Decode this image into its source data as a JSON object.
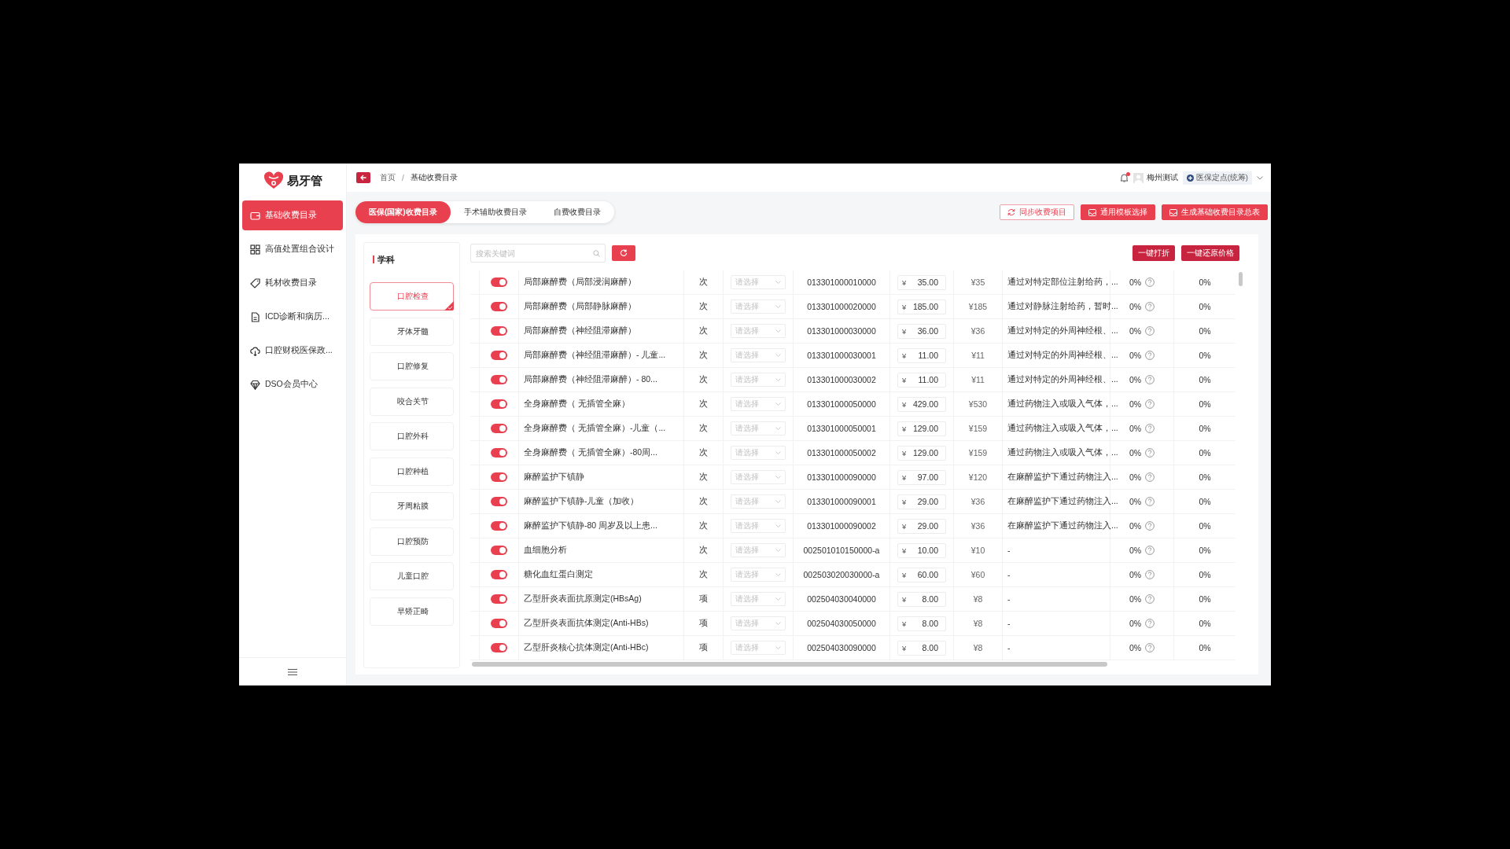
{
  "logo": {
    "text": "易牙管"
  },
  "sidebar": {
    "items": [
      {
        "label": "基础收费目录",
        "selected": true
      },
      {
        "label": "高值处置组合设计",
        "selected": false
      },
      {
        "label": "耗材收费目录",
        "selected": false
      },
      {
        "label": "ICD诊断和病历...",
        "selected": false
      },
      {
        "label": "口腔财税医保政...",
        "selected": false
      },
      {
        "label": "DSO会员中心",
        "selected": false
      }
    ]
  },
  "header": {
    "breadcrumb": [
      {
        "label": "首页"
      },
      {
        "label": "基础收费目录"
      }
    ],
    "separator": "/",
    "notification_dot": true,
    "user": "梅州测试",
    "org_badge": "医保定点(统筹)"
  },
  "tabs": [
    {
      "label": "医保(国家)收费目录",
      "selected": true
    },
    {
      "label": "手术辅助收费目录",
      "selected": false
    },
    {
      "label": "自费收费目录",
      "selected": false
    }
  ],
  "actions": [
    {
      "label": "同步收费项目",
      "kind": "outline"
    },
    {
      "label": "通用模板选择",
      "kind": "filled"
    },
    {
      "label": "生成基础收费目录总表",
      "kind": "filled"
    }
  ],
  "categories": {
    "title": "学科",
    "items": [
      {
        "label": "口腔检查",
        "selected": true
      },
      {
        "label": "牙体牙髓",
        "selected": false
      },
      {
        "label": "口腔修复",
        "selected": false
      },
      {
        "label": "咬合关节",
        "selected": false
      },
      {
        "label": "口腔外科",
        "selected": false
      },
      {
        "label": "口腔种植",
        "selected": false
      },
      {
        "label": "牙周粘膜",
        "selected": false
      },
      {
        "label": "口腔预防",
        "selected": false
      },
      {
        "label": "儿童口腔",
        "selected": false
      },
      {
        "label": "早矫正畸",
        "selected": false
      }
    ]
  },
  "search": {
    "placeholder": "搜索关键词"
  },
  "table_actions": [
    "一键打折",
    "一键还原价格"
  ],
  "rows": [
    {
      "on": true,
      "name": "局部麻醉费（局部浸润麻醉）",
      "unit": "次",
      "category_placeholder": "请选择",
      "code": "013301000010000",
      "currency": "¥",
      "price": "35.00",
      "reference_price": "¥35",
      "description": "通过对特定部位注射给药，...",
      "rate": "0%",
      "discount": "0%"
    },
    {
      "on": true,
      "name": "局部麻醉费（局部静脉麻醉）",
      "unit": "次",
      "category_placeholder": "请选择",
      "code": "013301000020000",
      "currency": "¥",
      "price": "185.00",
      "reference_price": "¥185",
      "description": "通过对静脉注射给药，暂时...",
      "rate": "0%",
      "discount": "0%"
    },
    {
      "on": true,
      "name": "局部麻醉费（神经阻滞麻醉）",
      "unit": "次",
      "category_placeholder": "请选择",
      "code": "013301000030000",
      "currency": "¥",
      "price": "36.00",
      "reference_price": "¥36",
      "description": "通过对特定的外周神经根、...",
      "rate": "0%",
      "discount": "0%"
    },
    {
      "on": true,
      "name": "局部麻醉费（神经阻滞麻醉）- 儿童...",
      "unit": "次",
      "category_placeholder": "请选择",
      "code": "013301000030001",
      "currency": "¥",
      "price": "11.00",
      "reference_price": "¥11",
      "description": "通过对特定的外周神经根、...",
      "rate": "0%",
      "discount": "0%"
    },
    {
      "on": true,
      "name": "局部麻醉费（神经阻滞麻醉）- 80...",
      "unit": "次",
      "category_placeholder": "请选择",
      "code": "013301000030002",
      "currency": "¥",
      "price": "11.00",
      "reference_price": "¥11",
      "description": "通过对特定的外周神经根、...",
      "rate": "0%",
      "discount": "0%"
    },
    {
      "on": true,
      "name": "全身麻醉费（ 无插管全麻）",
      "unit": "次",
      "category_placeholder": "请选择",
      "code": "013301000050000",
      "currency": "¥",
      "price": "429.00",
      "reference_price": "¥530",
      "description": "通过药物注入或吸入气体，...",
      "rate": "0%",
      "discount": "0%"
    },
    {
      "on": true,
      "name": "全身麻醉费（ 无插管全麻）-儿童（...",
      "unit": "次",
      "category_placeholder": "请选择",
      "code": "013301000050001",
      "currency": "¥",
      "price": "129.00",
      "reference_price": "¥159",
      "description": "通过药物注入或吸入气体，...",
      "rate": "0%",
      "discount": "0%"
    },
    {
      "on": true,
      "name": "全身麻醉费（ 无插管全麻）-80周...",
      "unit": "次",
      "category_placeholder": "请选择",
      "code": "013301000050002",
      "currency": "¥",
      "price": "129.00",
      "reference_price": "¥159",
      "description": "通过药物注入或吸入气体，...",
      "rate": "0%",
      "discount": "0%"
    },
    {
      "on": true,
      "name": "麻醉监护下镇静",
      "unit": "次",
      "category_placeholder": "请选择",
      "code": "013301000090000",
      "currency": "¥",
      "price": "97.00",
      "reference_price": "¥120",
      "description": "在麻醉监护下通过药物注入...",
      "rate": "0%",
      "discount": "0%"
    },
    {
      "on": true,
      "name": "麻醉监护下镇静-儿童（加收）",
      "unit": "次",
      "category_placeholder": "请选择",
      "code": "013301000090001",
      "currency": "¥",
      "price": "29.00",
      "reference_price": "¥36",
      "description": "在麻醉监护下通过药物注入...",
      "rate": "0%",
      "discount": "0%"
    },
    {
      "on": true,
      "name": "麻醉监护下镇静-80 周岁及以上患...",
      "unit": "次",
      "category_placeholder": "请选择",
      "code": "013301000090002",
      "currency": "¥",
      "price": "29.00",
      "reference_price": "¥36",
      "description": "在麻醉监护下通过药物注入...",
      "rate": "0%",
      "discount": "0%"
    },
    {
      "on": true,
      "name": "血细胞分析",
      "unit": "次",
      "category_placeholder": "请选择",
      "code": "002501010150000-a",
      "currency": "¥",
      "price": "10.00",
      "reference_price": "¥10",
      "description": "-",
      "rate": "0%",
      "discount": "0%"
    },
    {
      "on": true,
      "name": "糖化血红蛋白测定",
      "unit": "次",
      "category_placeholder": "请选择",
      "code": "002503020030000-a",
      "currency": "¥",
      "price": "60.00",
      "reference_price": "¥60",
      "description": "-",
      "rate": "0%",
      "discount": "0%"
    },
    {
      "on": true,
      "name": "乙型肝炎表面抗原测定(HBsAg)",
      "unit": "项",
      "category_placeholder": "请选择",
      "code": "002504030040000",
      "currency": "¥",
      "price": "8.00",
      "reference_price": "¥8",
      "description": "-",
      "rate": "0%",
      "discount": "0%"
    },
    {
      "on": true,
      "name": "乙型肝炎表面抗体测定(Anti-HBs)",
      "unit": "项",
      "category_placeholder": "请选择",
      "code": "002504030050000",
      "currency": "¥",
      "price": "8.00",
      "reference_price": "¥8",
      "description": "-",
      "rate": "0%",
      "discount": "0%"
    },
    {
      "on": true,
      "name": "乙型肝炎核心抗体测定(Anti-HBc)",
      "unit": "项",
      "category_placeholder": "请选择",
      "code": "002504030090000",
      "currency": "¥",
      "price": "8.00",
      "reference_price": "¥8",
      "description": "-",
      "rate": "0%",
      "discount": "0%"
    }
  ]
}
